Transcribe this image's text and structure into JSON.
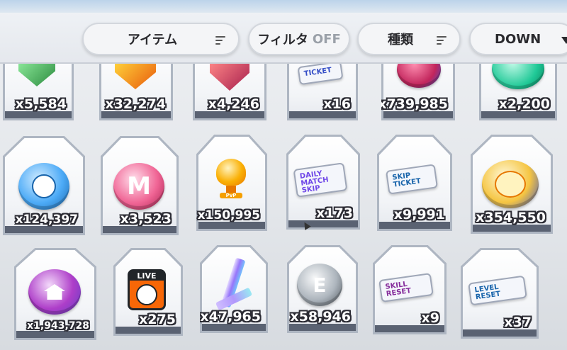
{
  "toolbar": {
    "item_sort_label": "アイテム",
    "filter_label": "フィルタ",
    "filter_state": "OFF",
    "type_label": "種類",
    "order_label": "DOWN"
  },
  "items": {
    "row1": [
      {
        "count": "x5,584",
        "icon": "green-shield-icon",
        "color": "#37b24d"
      },
      {
        "count": "x32,274",
        "icon": "orange-shield-icon",
        "color": "#f59f00"
      },
      {
        "count": "x4,246",
        "icon": "red-shield-icon",
        "color": "#e03131"
      },
      {
        "count": "x16",
        "icon": "ticket-icon",
        "color": "#5c7cfa"
      },
      {
        "count": "x739,985",
        "icon": "pink-gem-coin-icon",
        "color": "#e64980"
      },
      {
        "count": "x2,200",
        "icon": "teal-coin-icon",
        "color": "#38d9a9"
      }
    ],
    "row2": [
      {
        "count": "x124,397",
        "icon": "blue-volleyball-coin-icon",
        "color": "#4dabf7"
      },
      {
        "count": "x3,523",
        "icon": "pink-m-coin-icon",
        "color": "#f06595",
        "glyph": "M"
      },
      {
        "count": "x150,995",
        "icon": "gold-trophy-icon",
        "color": "#fab005",
        "glyph": "PvP"
      },
      {
        "count": "x173",
        "icon": "daily-match-skip-ticket-icon",
        "color": "#7950f2",
        "ticket": "DAILY MATCH SKIP"
      },
      {
        "count": "x9,991",
        "icon": "skip-ticket-icon",
        "color": "#1c7ed6",
        "ticket": "SKIP TICKET"
      },
      {
        "count": "x354,550",
        "icon": "gold-volleyball-coin-icon",
        "color": "#f5c542"
      }
    ],
    "row3": [
      {
        "count": "x1,943,728",
        "icon": "purple-house-coin-icon",
        "color": "#9c36b5"
      },
      {
        "count": "x275",
        "icon": "live-volleyball-icon",
        "color": "#f76707",
        "glyph": "LIVE"
      },
      {
        "count": "x47,965",
        "icon": "crystal-l-icon",
        "color": "#b197fc"
      },
      {
        "count": "x58,946",
        "icon": "silver-e-coin-icon",
        "color": "#adb5bd",
        "glyph": "E"
      },
      {
        "count": "x9",
        "icon": "skill-reset-ticket-icon",
        "color": "#e599f7",
        "ticket": "SKILL RESET"
      },
      {
        "count": "x37",
        "icon": "level-reset-ticket-icon",
        "color": "#74c0fc",
        "ticket": "LEVEL RESET"
      }
    ]
  }
}
